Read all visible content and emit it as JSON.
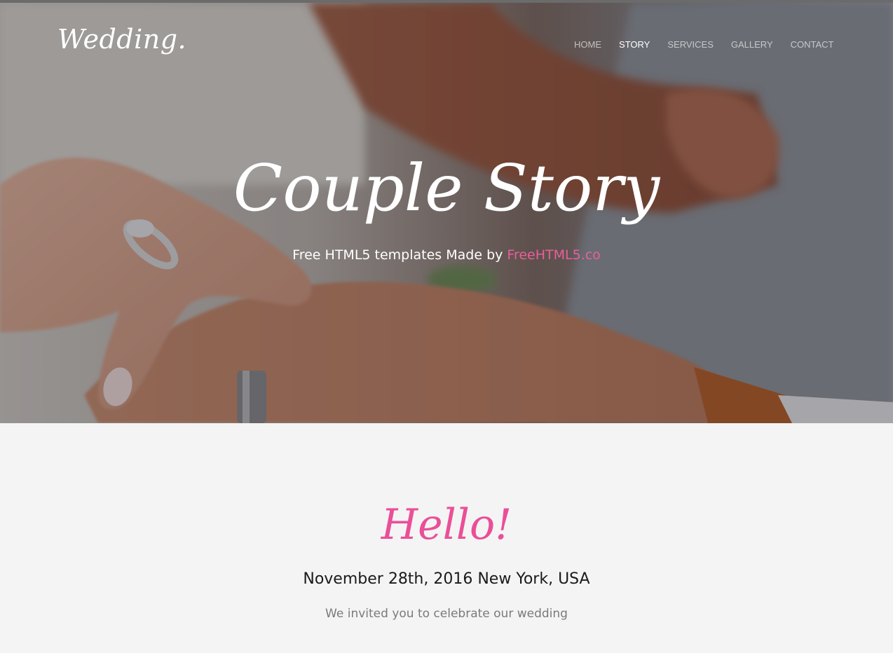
{
  "header": {
    "logo": "Wedding.",
    "nav": [
      {
        "label": "HOME",
        "active": false
      },
      {
        "label": "STORY",
        "active": true
      },
      {
        "label": "SERVICES",
        "active": false
      },
      {
        "label": "GALLERY",
        "active": false
      },
      {
        "label": "CONTACT",
        "active": false
      }
    ]
  },
  "hero": {
    "title": "Couple Story",
    "subtitle_prefix": "Free HTML5 templates Made by ",
    "subtitle_link": "FreeHTML5.co",
    "image_subject": "hands-with-wedding-rings-photo"
  },
  "intro": {
    "heading": "Hello!",
    "date_location": "November 28th, 2016 New York, USA",
    "invitation": "We invited you to celebrate our wedding"
  },
  "colors": {
    "accent": "#ea4f98",
    "link": "#e95f9b",
    "section_bg": "#f4f4f4",
    "nav_inactive": "rgba(255,255,255,0.62)",
    "nav_active": "#ffffff"
  }
}
